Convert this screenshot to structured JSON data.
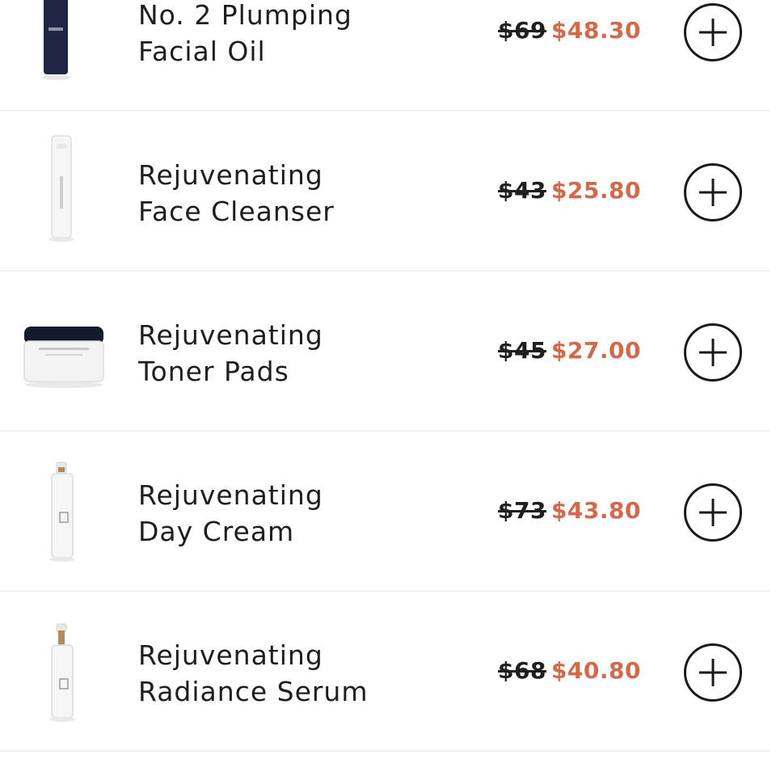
{
  "products": [
    {
      "name_line1": "No. 2 Plumping",
      "name_line2": "Facial Oil",
      "old_price": "$69",
      "new_price": "$48.30",
      "image": "navy-dropper-bottle",
      "add_icon": "plus-circle-icon"
    },
    {
      "name_line1": "Rejuvenating",
      "name_line2": "Face Cleanser",
      "old_price": "$43",
      "new_price": "$25.80",
      "image": "white-tube-bottle",
      "add_icon": "plus-circle-icon"
    },
    {
      "name_line1": "Rejuvenating",
      "name_line2": "Toner Pads",
      "old_price": "$45",
      "new_price": "$27.00",
      "image": "white-jar-navy-lid",
      "add_icon": "plus-circle-icon"
    },
    {
      "name_line1": "Rejuvenating",
      "name_line2": "Day Cream",
      "old_price": "$73",
      "new_price": "$43.80",
      "image": "white-pump-bottle",
      "add_icon": "plus-circle-icon"
    },
    {
      "name_line1": "Rejuvenating",
      "name_line2": "Radiance Serum",
      "old_price": "$68",
      "new_price": "$40.80",
      "image": "white-dropper-bottle",
      "add_icon": "plus-circle-icon"
    }
  ],
  "colors": {
    "sale_price": "#d4694a",
    "divider": "#f0f0f0",
    "text": "#1e1e1e"
  }
}
